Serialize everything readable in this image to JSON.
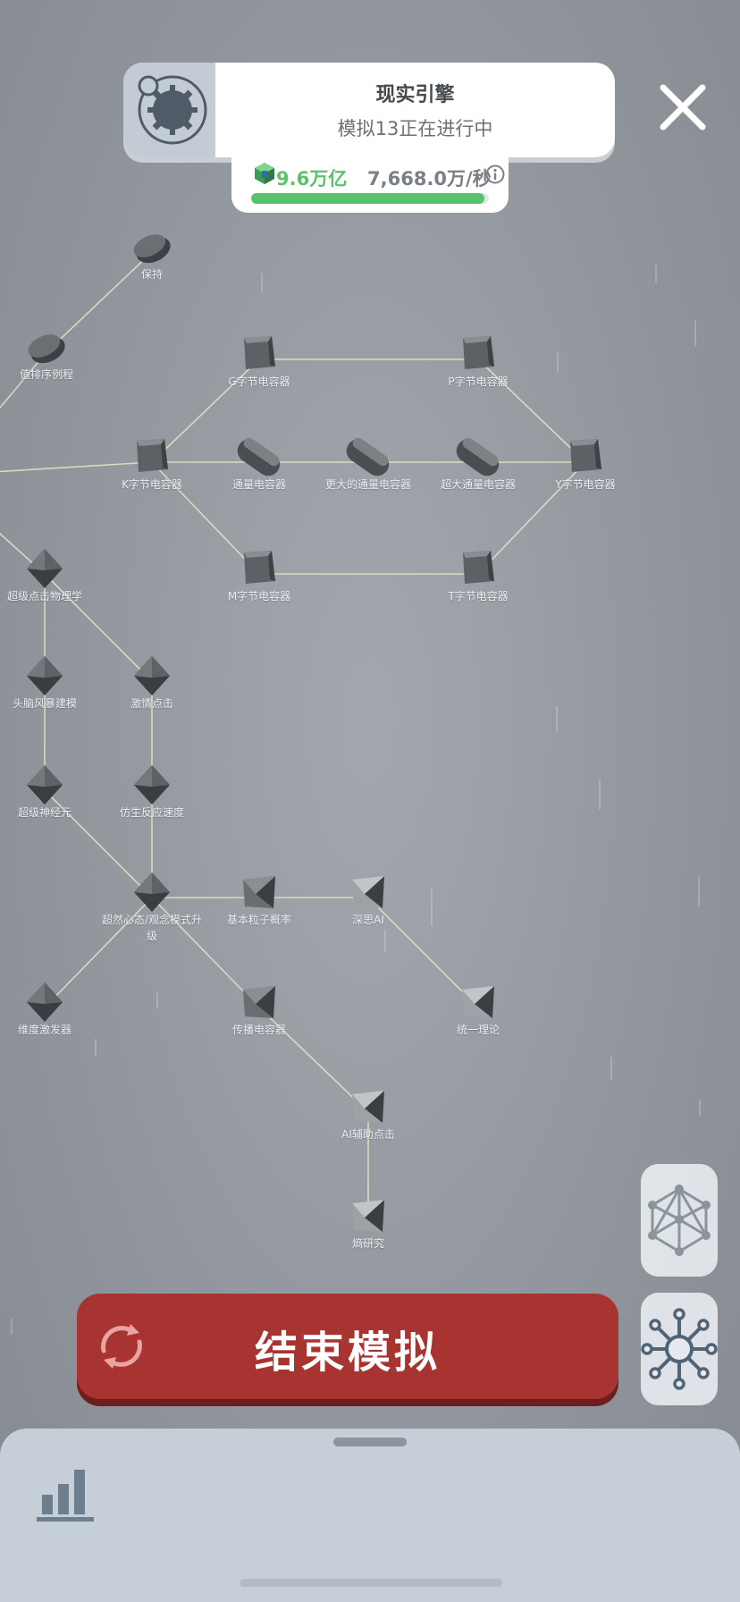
{
  "header": {
    "title": "现实引擎",
    "subtitle": "模拟13正在进行中",
    "icon": "engine-gear-icon"
  },
  "resource": {
    "amount": "9.6万亿",
    "rate": "7,668.0万/秒",
    "progress_fraction": 0.98,
    "icon": "green-cube-icon",
    "info_icon": "info-icon"
  },
  "colors": {
    "end_button": "#a73431",
    "accent_green": "#57c26a",
    "panel": "#c6cfd7"
  },
  "end_button": {
    "label": "结束模拟",
    "icon": "refresh-icon"
  },
  "side_buttons": [
    {
      "icon": "network-mesh-icon"
    },
    {
      "icon": "neural-hub-icon"
    }
  ],
  "bottom_panel": {
    "icon": "bar-chart-icon"
  },
  "upgrade_tree": {
    "nodes": [
      {
        "id": "n_keep",
        "label": "保持",
        "shape": "disc"
      },
      {
        "id": "n_sort",
        "label": "值排序例程",
        "shape": "disc"
      },
      {
        "id": "n_g",
        "label": "G字节电容器",
        "shape": "cube"
      },
      {
        "id": "n_p",
        "label": "P字节电容器",
        "shape": "cube"
      },
      {
        "id": "n_k",
        "label": "K字节电容器",
        "shape": "cube"
      },
      {
        "id": "n_flux",
        "label": "通量电容器",
        "shape": "capsule"
      },
      {
        "id": "n_flux2",
        "label": "更大的通量电容器",
        "shape": "capsule"
      },
      {
        "id": "n_flux3",
        "label": "超大通量电容器",
        "shape": "capsule"
      },
      {
        "id": "n_y",
        "label": "Y字节电容器",
        "shape": "cube"
      },
      {
        "id": "n_m",
        "label": "M字节电容器",
        "shape": "cube"
      },
      {
        "id": "n_t",
        "label": "T字节电容器",
        "shape": "cube"
      },
      {
        "id": "n_phys",
        "label": "超级点击物理学",
        "shape": "octa"
      },
      {
        "id": "n_brain",
        "label": "头脑风暴建模",
        "shape": "octa"
      },
      {
        "id": "n_passion",
        "label": "激情点击",
        "shape": "octa"
      },
      {
        "id": "n_neuron",
        "label": "超级神经元",
        "shape": "octa"
      },
      {
        "id": "n_bionic",
        "label": "仿生反应速度",
        "shape": "octa"
      },
      {
        "id": "n_super",
        "label": "超然心态/观念模式升级",
        "shape": "octa"
      },
      {
        "id": "n_particle",
        "label": "基本粒子概率",
        "shape": "pyramid"
      },
      {
        "id": "n_deep",
        "label": "深思AI",
        "shape": "pyramid-light"
      },
      {
        "id": "n_dim",
        "label": "维度激发器",
        "shape": "octa"
      },
      {
        "id": "n_prop",
        "label": "传播电容器",
        "shape": "pyramid"
      },
      {
        "id": "n_unify",
        "label": "统一理论",
        "shape": "pyramid-light"
      },
      {
        "id": "n_ai",
        "label": "AI辅助点击",
        "shape": "pyramid-light"
      },
      {
        "id": "n_entropy",
        "label": "熵研究",
        "shape": "pyramid-light"
      }
    ],
    "edges": [
      [
        "n_keep",
        "n_sort"
      ],
      [
        "n_sort",
        "edge_left_1"
      ],
      [
        "n_g",
        "n_p"
      ],
      [
        "n_g",
        "n_k"
      ],
      [
        "n_p",
        "n_y"
      ],
      [
        "edge_left_2",
        "n_k"
      ],
      [
        "n_k",
        "n_flux"
      ],
      [
        "n_flux",
        "n_flux2"
      ],
      [
        "n_flux2",
        "n_flux3"
      ],
      [
        "n_flux3",
        "n_y"
      ],
      [
        "n_k",
        "n_m"
      ],
      [
        "n_m",
        "n_t"
      ],
      [
        "n_t",
        "n_y"
      ],
      [
        "edge_left_3",
        "n_phys"
      ],
      [
        "n_phys",
        "n_brain"
      ],
      [
        "n_phys",
        "n_passion"
      ],
      [
        "n_brain",
        "n_neuron"
      ],
      [
        "n_passion",
        "n_bionic"
      ],
      [
        "n_neuron",
        "n_super"
      ],
      [
        "n_bionic",
        "n_super"
      ],
      [
        "n_super",
        "n_particle"
      ],
      [
        "n_particle",
        "n_deep"
      ],
      [
        "n_super",
        "n_dim"
      ],
      [
        "n_super",
        "n_prop"
      ],
      [
        "n_deep",
        "n_unify"
      ],
      [
        "n_prop",
        "n_ai"
      ],
      [
        "n_ai",
        "n_entropy"
      ]
    ]
  }
}
